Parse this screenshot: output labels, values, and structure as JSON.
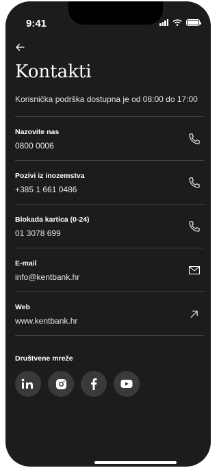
{
  "status": {
    "time": "9:41"
  },
  "header": {
    "title": "Kontakti",
    "subtitle": "Korisnička podrška dostupna je od 08:00 do 17:00"
  },
  "contacts": [
    {
      "label": "Nazovite nas",
      "value": "0800 0006",
      "icon": "phone-icon"
    },
    {
      "label": "Pozivi iz inozemstva",
      "value": "+385 1 661 0486",
      "icon": "phone-icon"
    },
    {
      "label": "Blokada kartica (0-24)",
      "value": "01 3078 699",
      "icon": "phone-icon"
    },
    {
      "label": "E-mail",
      "value": "info@kentbank.hr",
      "icon": "mail-icon"
    },
    {
      "label": "Web",
      "value": "www.kentbank.hr",
      "icon": "external-link-icon"
    }
  ],
  "social": {
    "title": "Društvene mreže",
    "items": [
      {
        "name": "LinkedIn",
        "icon": "linkedin-icon"
      },
      {
        "name": "Instagram",
        "icon": "instagram-icon"
      },
      {
        "name": "Facebook",
        "icon": "facebook-icon"
      },
      {
        "name": "YouTube",
        "icon": "youtube-icon"
      }
    ]
  },
  "colors": {
    "background": "#1c1c1c",
    "separator": "#444444",
    "social_bg": "#3a3a3a",
    "text": "#ffffff"
  }
}
